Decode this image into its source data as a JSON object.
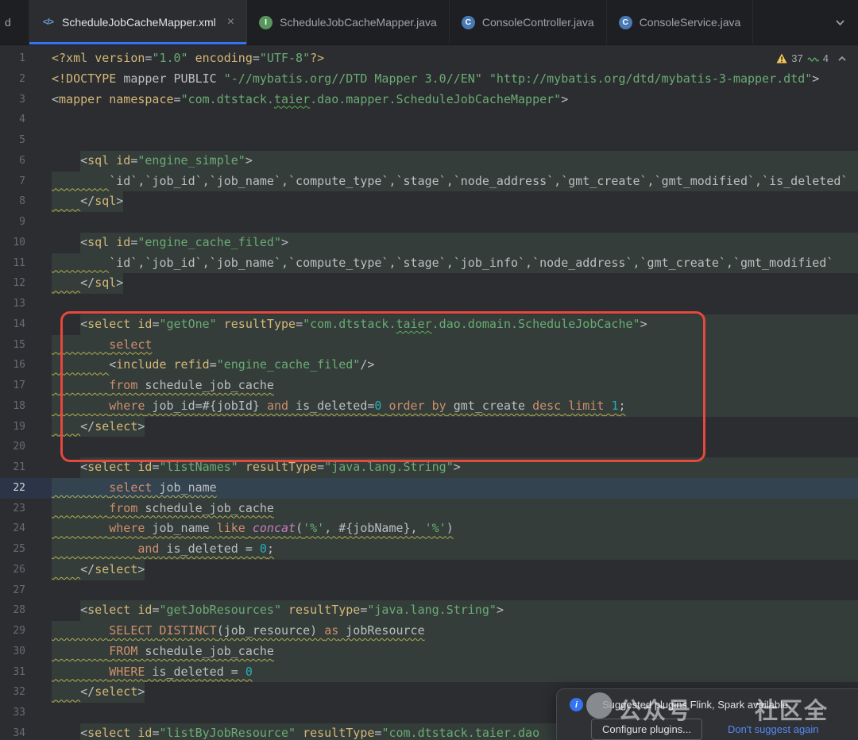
{
  "tab_bar": {
    "items": [
      {
        "label": "d",
        "partial": true
      },
      {
        "label": "ScheduleJobCacheMapper.xml",
        "icon": "xml",
        "active": true,
        "close": true
      },
      {
        "label": "ScheduleJobCacheMapper.java",
        "icon": "interface"
      },
      {
        "label": "ConsoleController.java",
        "icon": "class"
      },
      {
        "label": "ConsoleService.java",
        "icon": "class"
      }
    ]
  },
  "icons": {
    "xml": "</>",
    "interface": "I",
    "class": "C",
    "close": "×",
    "info": "i"
  },
  "inspections": {
    "warning_count": "37",
    "typo_count": "4"
  },
  "popup": {
    "message": "Suggested plugins Flink, Spark available.",
    "configure_label": "Configure plugins...",
    "dismiss_label": "Don't suggest again"
  },
  "watermark": {
    "text_left": "公众号",
    "text_right": "社区全"
  },
  "colors": {
    "accent_blue": "#3574f0",
    "annotation_red": "#e5483c",
    "warning_yellow": "#f2c55c",
    "typo_green": "#57965c",
    "link_blue": "#548af7",
    "string_green": "#6aab73",
    "keyword_orange": "#cf8e6d",
    "tag_yellow": "#d5b778",
    "number_cyan": "#2aacb8",
    "fragment_bg": "#343d3a",
    "editor_bg": "#2b2d30",
    "tabbar_bg": "#1e1f22"
  },
  "editor": {
    "lines": [
      {
        "num": 1,
        "tokens": [
          [
            "tag",
            "<?xml "
          ],
          [
            "attr",
            "version"
          ],
          [
            "t",
            "="
          ],
          [
            "str",
            "\"1.0\""
          ],
          [
            "t",
            " "
          ],
          [
            "attr",
            "encoding"
          ],
          [
            "t",
            "="
          ],
          [
            "str",
            "\"UTF-8\""
          ],
          [
            "tag",
            "?>"
          ]
        ]
      },
      {
        "num": 2,
        "tokens": [
          [
            "tag",
            "<!DOCTYPE "
          ],
          [
            "t",
            "mapper PUBLIC "
          ],
          [
            "str",
            "\"-//mybatis.org//DTD Mapper 3.0//EN\""
          ],
          [
            "t",
            " "
          ],
          [
            "str",
            "\"http://mybatis.org/dtd/mybatis-3-mapper.dtd\""
          ],
          [
            "t",
            ">"
          ]
        ]
      },
      {
        "num": 3,
        "tokens": [
          [
            "t",
            "<"
          ],
          [
            "tag",
            "mapper"
          ],
          [
            "t",
            " "
          ],
          [
            "attr",
            "namespace"
          ],
          [
            "t",
            "="
          ],
          [
            "str",
            "\"com.dtstack."
          ],
          [
            "str typo",
            "taier"
          ],
          [
            "str",
            ".dao.mapper.ScheduleJobCacheMapper\""
          ],
          [
            "t",
            ">"
          ]
        ]
      },
      {
        "num": 4,
        "tokens": []
      },
      {
        "num": 5,
        "tokens": []
      },
      {
        "num": 6,
        "frag": [
          4,
          null
        ],
        "tokens": [
          [
            "sp",
            "    "
          ],
          [
            "t",
            "<"
          ],
          [
            "tag",
            "sql"
          ],
          [
            "t",
            " "
          ],
          [
            "attr",
            "id"
          ],
          [
            "t",
            "="
          ],
          [
            "str",
            "\"engine_simple\""
          ],
          [
            "t",
            ">"
          ]
        ]
      },
      {
        "num": 7,
        "frag": [
          0,
          null
        ],
        "wavy": "indent",
        "tokens": [
          [
            "sp",
            "        "
          ],
          [
            "t",
            "`id`,`job_id`,`job_name`,`compute_type`,`stage`,`node_address`,`gmt_create`,`gmt_modified`,`is_deleted`"
          ]
        ]
      },
      {
        "num": 8,
        "frag": [
          0,
          10
        ],
        "wavy": "indent",
        "tokens": [
          [
            "sp",
            "    "
          ],
          [
            "t",
            "</"
          ],
          [
            "tag",
            "sql"
          ],
          [
            "t",
            ">"
          ]
        ]
      },
      {
        "num": 9,
        "tokens": []
      },
      {
        "num": 10,
        "frag": [
          4,
          null
        ],
        "tokens": [
          [
            "sp",
            "    "
          ],
          [
            "t",
            "<"
          ],
          [
            "tag",
            "sql"
          ],
          [
            "t",
            " "
          ],
          [
            "attr",
            "id"
          ],
          [
            "t",
            "="
          ],
          [
            "str",
            "\"engine_cache_filed\""
          ],
          [
            "t",
            ">"
          ]
        ]
      },
      {
        "num": 11,
        "frag": [
          0,
          null
        ],
        "wavy": "indent",
        "tokens": [
          [
            "sp",
            "        "
          ],
          [
            "t",
            "`id`,`job_id`,`job_name`,`compute_type`,`stage`,`job_info`,`node_address`,`gmt_create`,`gmt_modified`"
          ]
        ]
      },
      {
        "num": 12,
        "frag": [
          0,
          10
        ],
        "wavy": "indent",
        "tokens": [
          [
            "sp",
            "    "
          ],
          [
            "t",
            "</"
          ],
          [
            "tag",
            "sql"
          ],
          [
            "t",
            ">"
          ]
        ]
      },
      {
        "num": 13,
        "tokens": []
      },
      {
        "num": 14,
        "frag": [
          4,
          null
        ],
        "tokens": [
          [
            "sp",
            "    "
          ],
          [
            "t",
            "<"
          ],
          [
            "tag",
            "select"
          ],
          [
            "t",
            " "
          ],
          [
            "attr",
            "id"
          ],
          [
            "t",
            "="
          ],
          [
            "str",
            "\"getOne\""
          ],
          [
            "t",
            " "
          ],
          [
            "attr",
            "resultType"
          ],
          [
            "t",
            "="
          ],
          [
            "str",
            "\"com.dtstack."
          ],
          [
            "str typo",
            "taier"
          ],
          [
            "str",
            ".dao.domain.ScheduleJobCache\""
          ],
          [
            "t",
            ">"
          ]
        ]
      },
      {
        "num": 15,
        "frag": [
          0,
          null
        ],
        "wavy": "full",
        "tokens": [
          [
            "sp",
            "        "
          ],
          [
            "kw",
            "select"
          ]
        ]
      },
      {
        "num": 16,
        "frag": [
          0,
          null
        ],
        "wavy": "indent",
        "tokens": [
          [
            "sp",
            "        "
          ],
          [
            "t",
            "<"
          ],
          [
            "tag",
            "include"
          ],
          [
            "t",
            " "
          ],
          [
            "attr",
            "refid"
          ],
          [
            "t",
            "="
          ],
          [
            "str",
            "\"engine_cache_filed\""
          ],
          [
            "t",
            "/>"
          ]
        ]
      },
      {
        "num": 17,
        "frag": [
          0,
          null
        ],
        "wavy": "full",
        "tokens": [
          [
            "sp",
            "        "
          ],
          [
            "kw",
            "from"
          ],
          [
            "t",
            " schedule_job_cache"
          ]
        ]
      },
      {
        "num": 18,
        "frag": [
          0,
          null
        ],
        "wavy": "full",
        "tokens": [
          [
            "sp",
            "        "
          ],
          [
            "kw",
            "where"
          ],
          [
            "t",
            " job_id=#{jobId} "
          ],
          [
            "kw",
            "and"
          ],
          [
            "t",
            " is_deleted="
          ],
          [
            "num",
            "0"
          ],
          [
            "t",
            " "
          ],
          [
            "kw",
            "order by"
          ],
          [
            "t",
            " gmt_create "
          ],
          [
            "kw",
            "desc"
          ],
          [
            "t",
            " "
          ],
          [
            "kw",
            "limit"
          ],
          [
            "t",
            " "
          ],
          [
            "num",
            "1"
          ],
          [
            "t",
            ";"
          ]
        ]
      },
      {
        "num": 19,
        "frag": [
          0,
          13
        ],
        "wavy": "indent",
        "tokens": [
          [
            "sp",
            "    "
          ],
          [
            "t",
            "</"
          ],
          [
            "tag",
            "select"
          ],
          [
            "t",
            ">"
          ]
        ]
      },
      {
        "num": 20,
        "tokens": []
      },
      {
        "num": 21,
        "frag": [
          4,
          null
        ],
        "tokens": [
          [
            "sp",
            "    "
          ],
          [
            "t",
            "<"
          ],
          [
            "tag",
            "select"
          ],
          [
            "t",
            " "
          ],
          [
            "attr",
            "id"
          ],
          [
            "t",
            "="
          ],
          [
            "str",
            "\"listNames\""
          ],
          [
            "t",
            " "
          ],
          [
            "attr",
            "resultType"
          ],
          [
            "t",
            "="
          ],
          [
            "str",
            "\"java.lang.String\""
          ],
          [
            "t",
            ">"
          ]
        ]
      },
      {
        "num": 22,
        "caret": true,
        "frag": [
          0,
          null
        ],
        "wavy": "full",
        "tokens": [
          [
            "sp",
            "        "
          ],
          [
            "kw",
            "select"
          ],
          [
            "t",
            " job_name"
          ]
        ]
      },
      {
        "num": 23,
        "frag": [
          0,
          null
        ],
        "wavy": "full",
        "tokens": [
          [
            "sp",
            "        "
          ],
          [
            "kw",
            "from"
          ],
          [
            "t",
            " schedule_job_cache"
          ]
        ]
      },
      {
        "num": 24,
        "frag": [
          0,
          null
        ],
        "wavy": "full",
        "tokens": [
          [
            "sp",
            "        "
          ],
          [
            "kw",
            "where"
          ],
          [
            "t",
            " job_name "
          ],
          [
            "kw",
            "like"
          ],
          [
            "t",
            " "
          ],
          [
            "fn",
            "concat"
          ],
          [
            "t",
            "("
          ],
          [
            "str",
            "'%'"
          ],
          [
            "t",
            ", #{jobName}, "
          ],
          [
            "str",
            "'%'"
          ],
          [
            "t",
            ")"
          ]
        ]
      },
      {
        "num": 25,
        "frag": [
          0,
          null
        ],
        "wavy": "full",
        "tokens": [
          [
            "sp",
            "            "
          ],
          [
            "kw",
            "and"
          ],
          [
            "t",
            " is_deleted = "
          ],
          [
            "num",
            "0"
          ],
          [
            "t",
            ";"
          ]
        ]
      },
      {
        "num": 26,
        "frag": [
          0,
          13
        ],
        "wavy": "indent",
        "tokens": [
          [
            "sp",
            "    "
          ],
          [
            "t",
            "</"
          ],
          [
            "tag",
            "select"
          ],
          [
            "t",
            ">"
          ]
        ]
      },
      {
        "num": 27,
        "tokens": []
      },
      {
        "num": 28,
        "frag": [
          4,
          null
        ],
        "tokens": [
          [
            "sp",
            "    "
          ],
          [
            "t",
            "<"
          ],
          [
            "tag",
            "select"
          ],
          [
            "t",
            " "
          ],
          [
            "attr",
            "id"
          ],
          [
            "t",
            "="
          ],
          [
            "str",
            "\"getJobResources\""
          ],
          [
            "t",
            " "
          ],
          [
            "attr",
            "resultType"
          ],
          [
            "t",
            "="
          ],
          [
            "str",
            "\"java.lang.String\""
          ],
          [
            "t",
            ">"
          ]
        ]
      },
      {
        "num": 29,
        "frag": [
          0,
          null
        ],
        "wavy": "full",
        "tokens": [
          [
            "sp",
            "        "
          ],
          [
            "kw",
            "SELECT"
          ],
          [
            "t",
            " "
          ],
          [
            "kw",
            "DISTINCT"
          ],
          [
            "t",
            "(job_resource) "
          ],
          [
            "kw",
            "as"
          ],
          [
            "t",
            " jobResource"
          ]
        ]
      },
      {
        "num": 30,
        "frag": [
          0,
          null
        ],
        "wavy": "full",
        "tokens": [
          [
            "sp",
            "        "
          ],
          [
            "kw",
            "FROM"
          ],
          [
            "t",
            " schedule_job_cache"
          ]
        ]
      },
      {
        "num": 31,
        "frag": [
          0,
          null
        ],
        "wavy": "full",
        "tokens": [
          [
            "sp",
            "        "
          ],
          [
            "kw",
            "WHERE"
          ],
          [
            "t",
            " is_deleted = "
          ],
          [
            "num",
            "0"
          ]
        ]
      },
      {
        "num": 32,
        "frag": [
          0,
          13
        ],
        "wavy": "indent",
        "tokens": [
          [
            "sp",
            "    "
          ],
          [
            "t",
            "</"
          ],
          [
            "tag",
            "select"
          ],
          [
            "t",
            ">"
          ]
        ]
      },
      {
        "num": 33,
        "tokens": []
      },
      {
        "num": 34,
        "frag": [
          4,
          null
        ],
        "tokens": [
          [
            "sp",
            "    "
          ],
          [
            "t",
            "<"
          ],
          [
            "tag",
            "select"
          ],
          [
            "t",
            " "
          ],
          [
            "attr",
            "id"
          ],
          [
            "t",
            "="
          ],
          [
            "str",
            "\"listByJobResource\""
          ],
          [
            "t",
            " "
          ],
          [
            "attr",
            "resultType"
          ],
          [
            "t",
            "="
          ],
          [
            "str",
            "\"com.dtstack."
          ],
          [
            "str typo",
            "taier"
          ],
          [
            "str",
            ".dao"
          ]
        ]
      }
    ]
  }
}
